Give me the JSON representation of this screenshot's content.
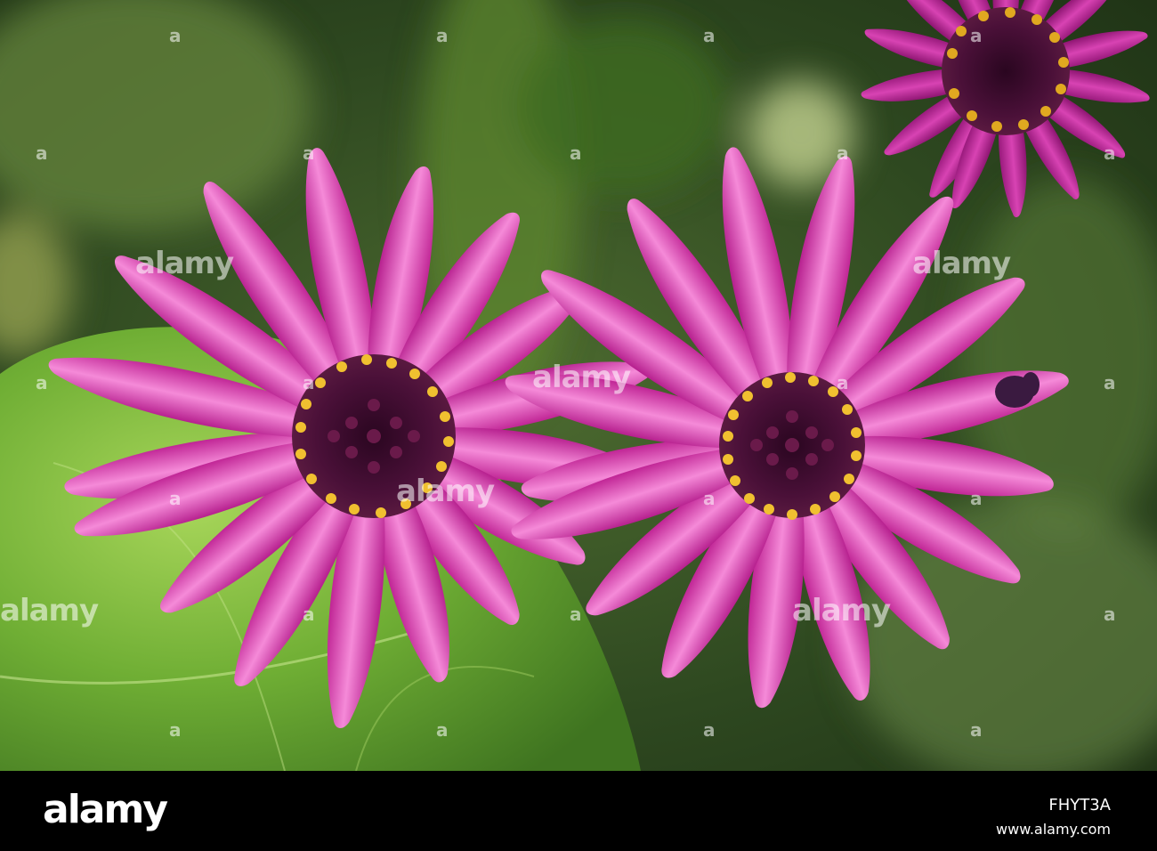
{
  "watermark": {
    "text": "alamy",
    "dot": "a"
  },
  "footer": {
    "brand": "alamy",
    "image_id": "FHYT3A",
    "url": "www.alamy.com"
  },
  "colors": {
    "petal": "#d62ca5",
    "petal_light": "#f07ad3",
    "center": "#3a0a2a",
    "pollen": "#e6b320",
    "leaf": "#6aa832",
    "background": "#2f4a22"
  }
}
